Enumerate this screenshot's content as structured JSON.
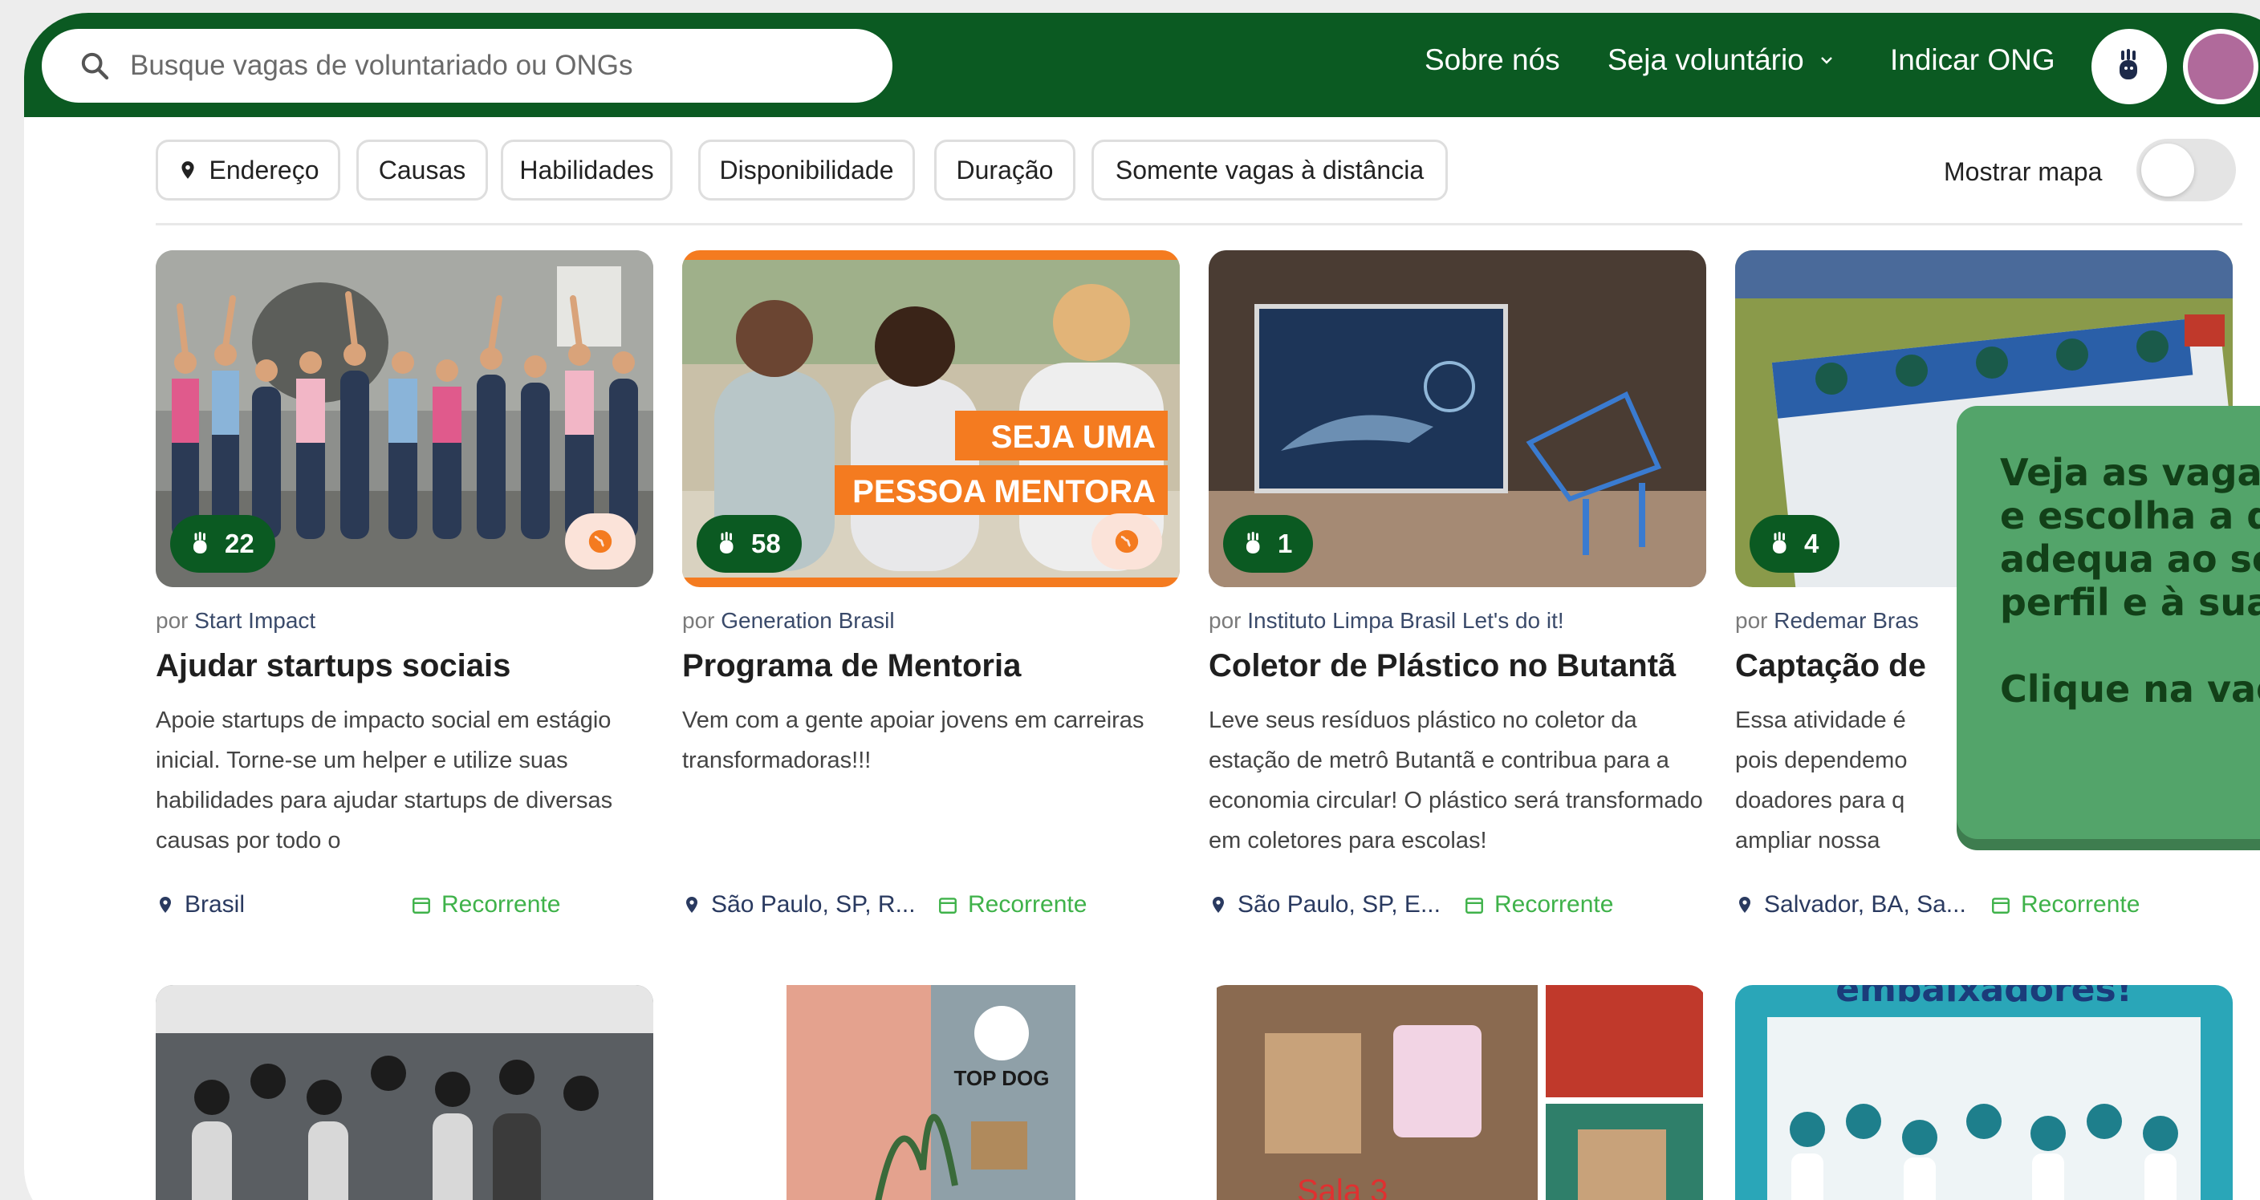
{
  "search": {
    "placeholder": "Busque vagas de voluntariado ou ONGs"
  },
  "nav": {
    "about": "Sobre nós",
    "volunteer": "Seja voluntário",
    "refer": "Indicar ONG"
  },
  "filters": {
    "address": "Endereço",
    "causes": "Causas",
    "skills": "Habilidades",
    "availability": "Disponibilidade",
    "duration": "Duração",
    "remote_only": "Somente vagas à distância",
    "show_map": "Mostrar mapa",
    "show_map_on": false
  },
  "by_prefix": "por",
  "cards": [
    {
      "org": "Start Impact",
      "count": "22",
      "remote": true,
      "title": "Ajudar startups sociais",
      "desc": "Apoie startups de impacto social em estágio inicial. Torne-se um helper e utilize suas habilidades para ajudar startups de diversas causas por todo o",
      "location": "Brasil",
      "frequency": "Recorrente"
    },
    {
      "org": "Generation Brasil",
      "count": "58",
      "remote": true,
      "image_text_1": "SEJA UMA",
      "image_text_2": "PESSOA MENTORA",
      "title": "Programa de Mentoria",
      "desc": "Vem com a gente apoiar jovens em carreiras transformadoras!!!",
      "location": "São Paulo, SP, R...",
      "frequency": "Recorrente"
    },
    {
      "org": "Instituto Limpa Brasil Let's do it!",
      "count": "1",
      "remote": false,
      "title": "Coletor de Plástico no Butantã",
      "desc": "Leve seus resíduos plástico no coletor da estação de metrô Butantã e contribua para a economia circular! O plástico será transformado em coletores para escolas!",
      "location": "São Paulo, SP, E...",
      "frequency": "Recorrente"
    },
    {
      "org": "Redemar Bras",
      "count": "4",
      "remote": false,
      "title": "Captação de",
      "desc": "Essa atividade é pois dependemo doadores para q ampliar nossa atuação.",
      "location": "Salvador, BA, Sa...",
      "frequency": "Recorrente"
    }
  ],
  "second_row": {
    "top_dog_sign": "TOP DOG",
    "classroom_sign": "Sala 3",
    "banner_text": "embaixadores!"
  },
  "callout": {
    "line1": "Veja as vagas",
    "line2": "e escolha a q",
    "line3": "adequa ao se",
    "line4": "perfil e à sua",
    "line5": "Clique na vag"
  },
  "colors": {
    "brand_green": "#0b5a22",
    "recurrent_green": "#3fb24a",
    "callout_green": "#53a46a",
    "accent_orange": "#f47b20"
  },
  "icons": {
    "search": "search-icon",
    "chevron": "chevron-down-icon",
    "pin": "location-pin-icon",
    "calendar": "calendar-icon",
    "hand": "waving-hand-icon",
    "globe": "globe-icon"
  }
}
